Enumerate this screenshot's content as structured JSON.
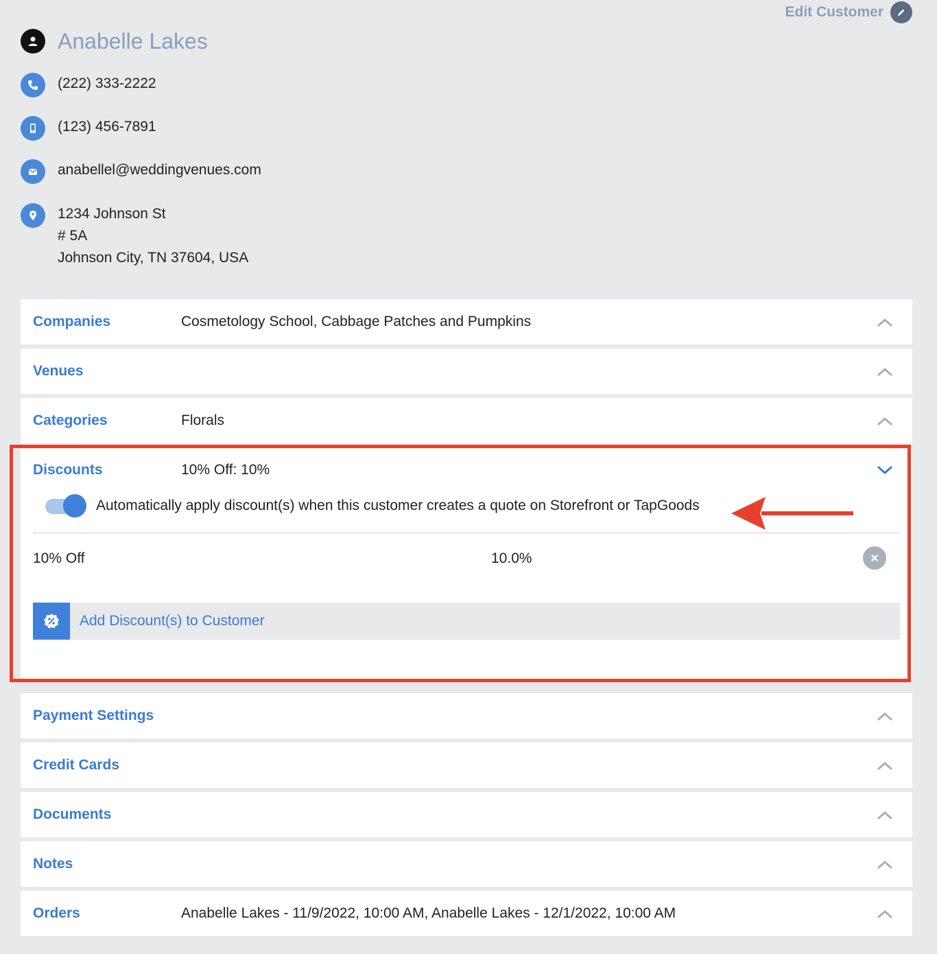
{
  "header": {
    "edit_customer_label": "Edit Customer"
  },
  "customer": {
    "name": "Anabelle Lakes",
    "phone": "(222) 333-2222",
    "mobile": "(123) 456-7891",
    "email": "anabellel@weddingvenues.com",
    "address_line1": "1234 Johnson St",
    "address_line2": "# 5A",
    "address_line3": "Johnson City, TN 37604, USA"
  },
  "sections": {
    "companies": {
      "title": "Companies",
      "summary": "Cosmetology School, Cabbage Patches and Pumpkins"
    },
    "venues": {
      "title": "Venues",
      "summary": ""
    },
    "categories": {
      "title": "Categories",
      "summary": "Florals"
    },
    "discounts": {
      "title": "Discounts",
      "summary": "10% Off: 10%",
      "auto_apply_label": "Automatically apply discount(s) when this customer creates a quote on Storefront or TapGoods",
      "auto_apply_enabled": true,
      "items": [
        {
          "name": "10% Off",
          "value": "10.0%"
        }
      ],
      "add_label": "Add Discount(s) to Customer"
    },
    "payment_settings": {
      "title": "Payment Settings",
      "summary": ""
    },
    "credit_cards": {
      "title": "Credit Cards",
      "summary": ""
    },
    "documents": {
      "title": "Documents",
      "summary": ""
    },
    "notes": {
      "title": "Notes",
      "summary": ""
    },
    "orders": {
      "title": "Orders",
      "summary": "Anabelle Lakes - 11/9/2022, 10:00 AM, Anabelle Lakes - 12/1/2022, 10:00 AM"
    }
  },
  "colors": {
    "accent": "#3a7bd5",
    "highlight": "#e8402c",
    "background": "#e8e9eb"
  }
}
